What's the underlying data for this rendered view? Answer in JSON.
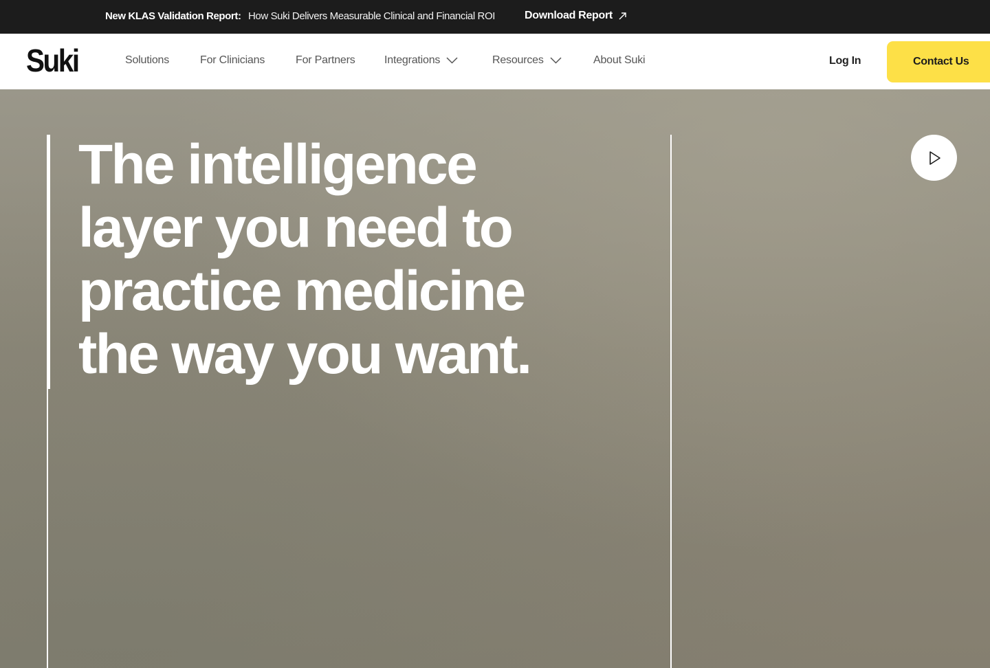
{
  "announcement": {
    "label": "New KLAS Validation Report:",
    "headline": "How Suki Delivers Measurable Clinical and Financial ROI",
    "cta": "Download Report",
    "cta_icon": "arrow-up-right-icon"
  },
  "nav": {
    "logo": "Suki",
    "items": [
      {
        "label": "Solutions",
        "has_dropdown": false
      },
      {
        "label": "For Clinicians",
        "has_dropdown": false
      },
      {
        "label": "For Partners",
        "has_dropdown": false
      },
      {
        "label": "Integrations",
        "has_dropdown": true
      },
      {
        "label": "Resources",
        "has_dropdown": true
      },
      {
        "label": "About Suki",
        "has_dropdown": false
      }
    ],
    "login": "Log In",
    "contact": "Contact Us"
  },
  "hero": {
    "title_lines": [
      "The intelligence",
      "layer you need to",
      "practice medicine",
      "the way you want."
    ],
    "play_icon": "play-icon"
  },
  "colors": {
    "announcement_bg": "#1c1c1c",
    "accent_yellow": "#fde047",
    "hero_bg": "#8a8574",
    "nav_text": "#555555"
  }
}
